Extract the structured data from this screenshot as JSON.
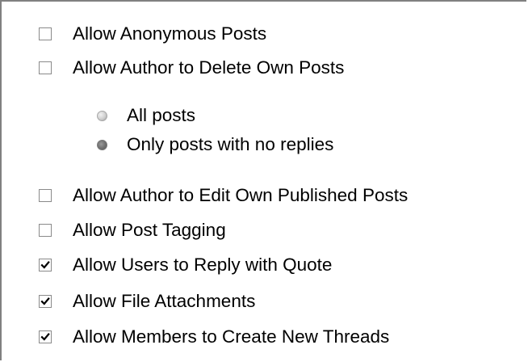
{
  "options": [
    {
      "label": "Allow Anonymous Posts",
      "checked": false
    },
    {
      "label": "Allow Author to Delete Own Posts",
      "checked": false
    },
    {
      "label": "Allow Author to Edit Own Published Posts",
      "checked": false
    },
    {
      "label": "Allow Post Tagging",
      "checked": false
    },
    {
      "label": "Allow Users to Reply with Quote",
      "checked": true
    },
    {
      "label": "Allow File Attachments",
      "checked": true
    },
    {
      "label": "Allow Members to Create New Threads",
      "checked": true
    }
  ],
  "delete_scope": {
    "choices": [
      {
        "label": "All posts",
        "selected": false
      },
      {
        "label": "Only posts with no replies",
        "selected": true
      }
    ]
  }
}
